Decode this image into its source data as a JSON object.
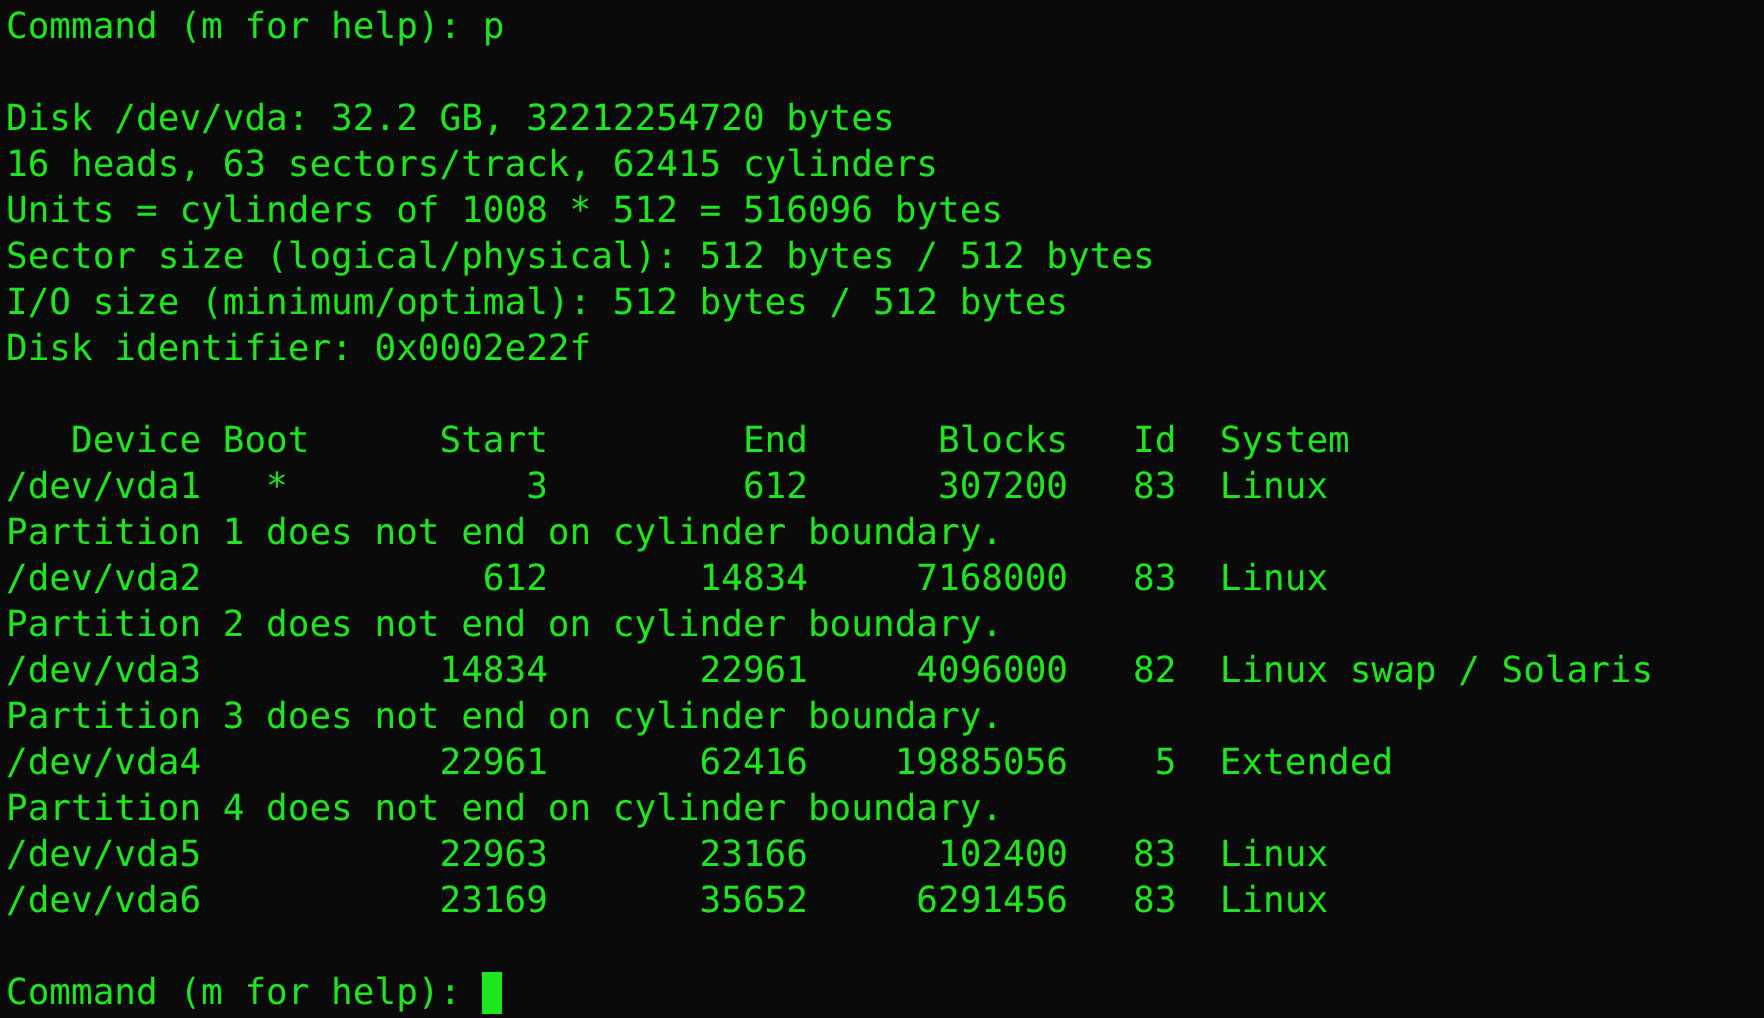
{
  "terminal": {
    "blocks": [
      [
        "Command (m for help): p"
      ],
      [
        "Disk /dev/vda: 32.2 GB, 32212254720 bytes",
        "16 heads, 63 sectors/track, 62415 cylinders",
        "Units = cylinders of 1008 * 512 = 516096 bytes",
        "Sector size (logical/physical): 512 bytes / 512 bytes",
        "I/O size (minimum/optimal): 512 bytes / 512 bytes",
        "Disk identifier: 0x0002e22f"
      ],
      [
        "   Device Boot      Start         End      Blocks   Id  System",
        "/dev/vda1   *           3         612      307200   83  Linux",
        "Partition 1 does not end on cylinder boundary.",
        "/dev/vda2             612       14834     7168000   83  Linux",
        "Partition 2 does not end on cylinder boundary.",
        "/dev/vda3           14834       22961     4096000   82  Linux swap / Solaris",
        "Partition 3 does not end on cylinder boundary.",
        "/dev/vda4           22961       62416    19885056    5  Extended",
        "Partition 4 does not end on cylinder boundary.",
        "/dev/vda5           22963       23166      102400   83  Linux",
        "/dev/vda6           23169       35652     6291456   83  Linux"
      ]
    ],
    "prompt": "Command (m for help): "
  }
}
